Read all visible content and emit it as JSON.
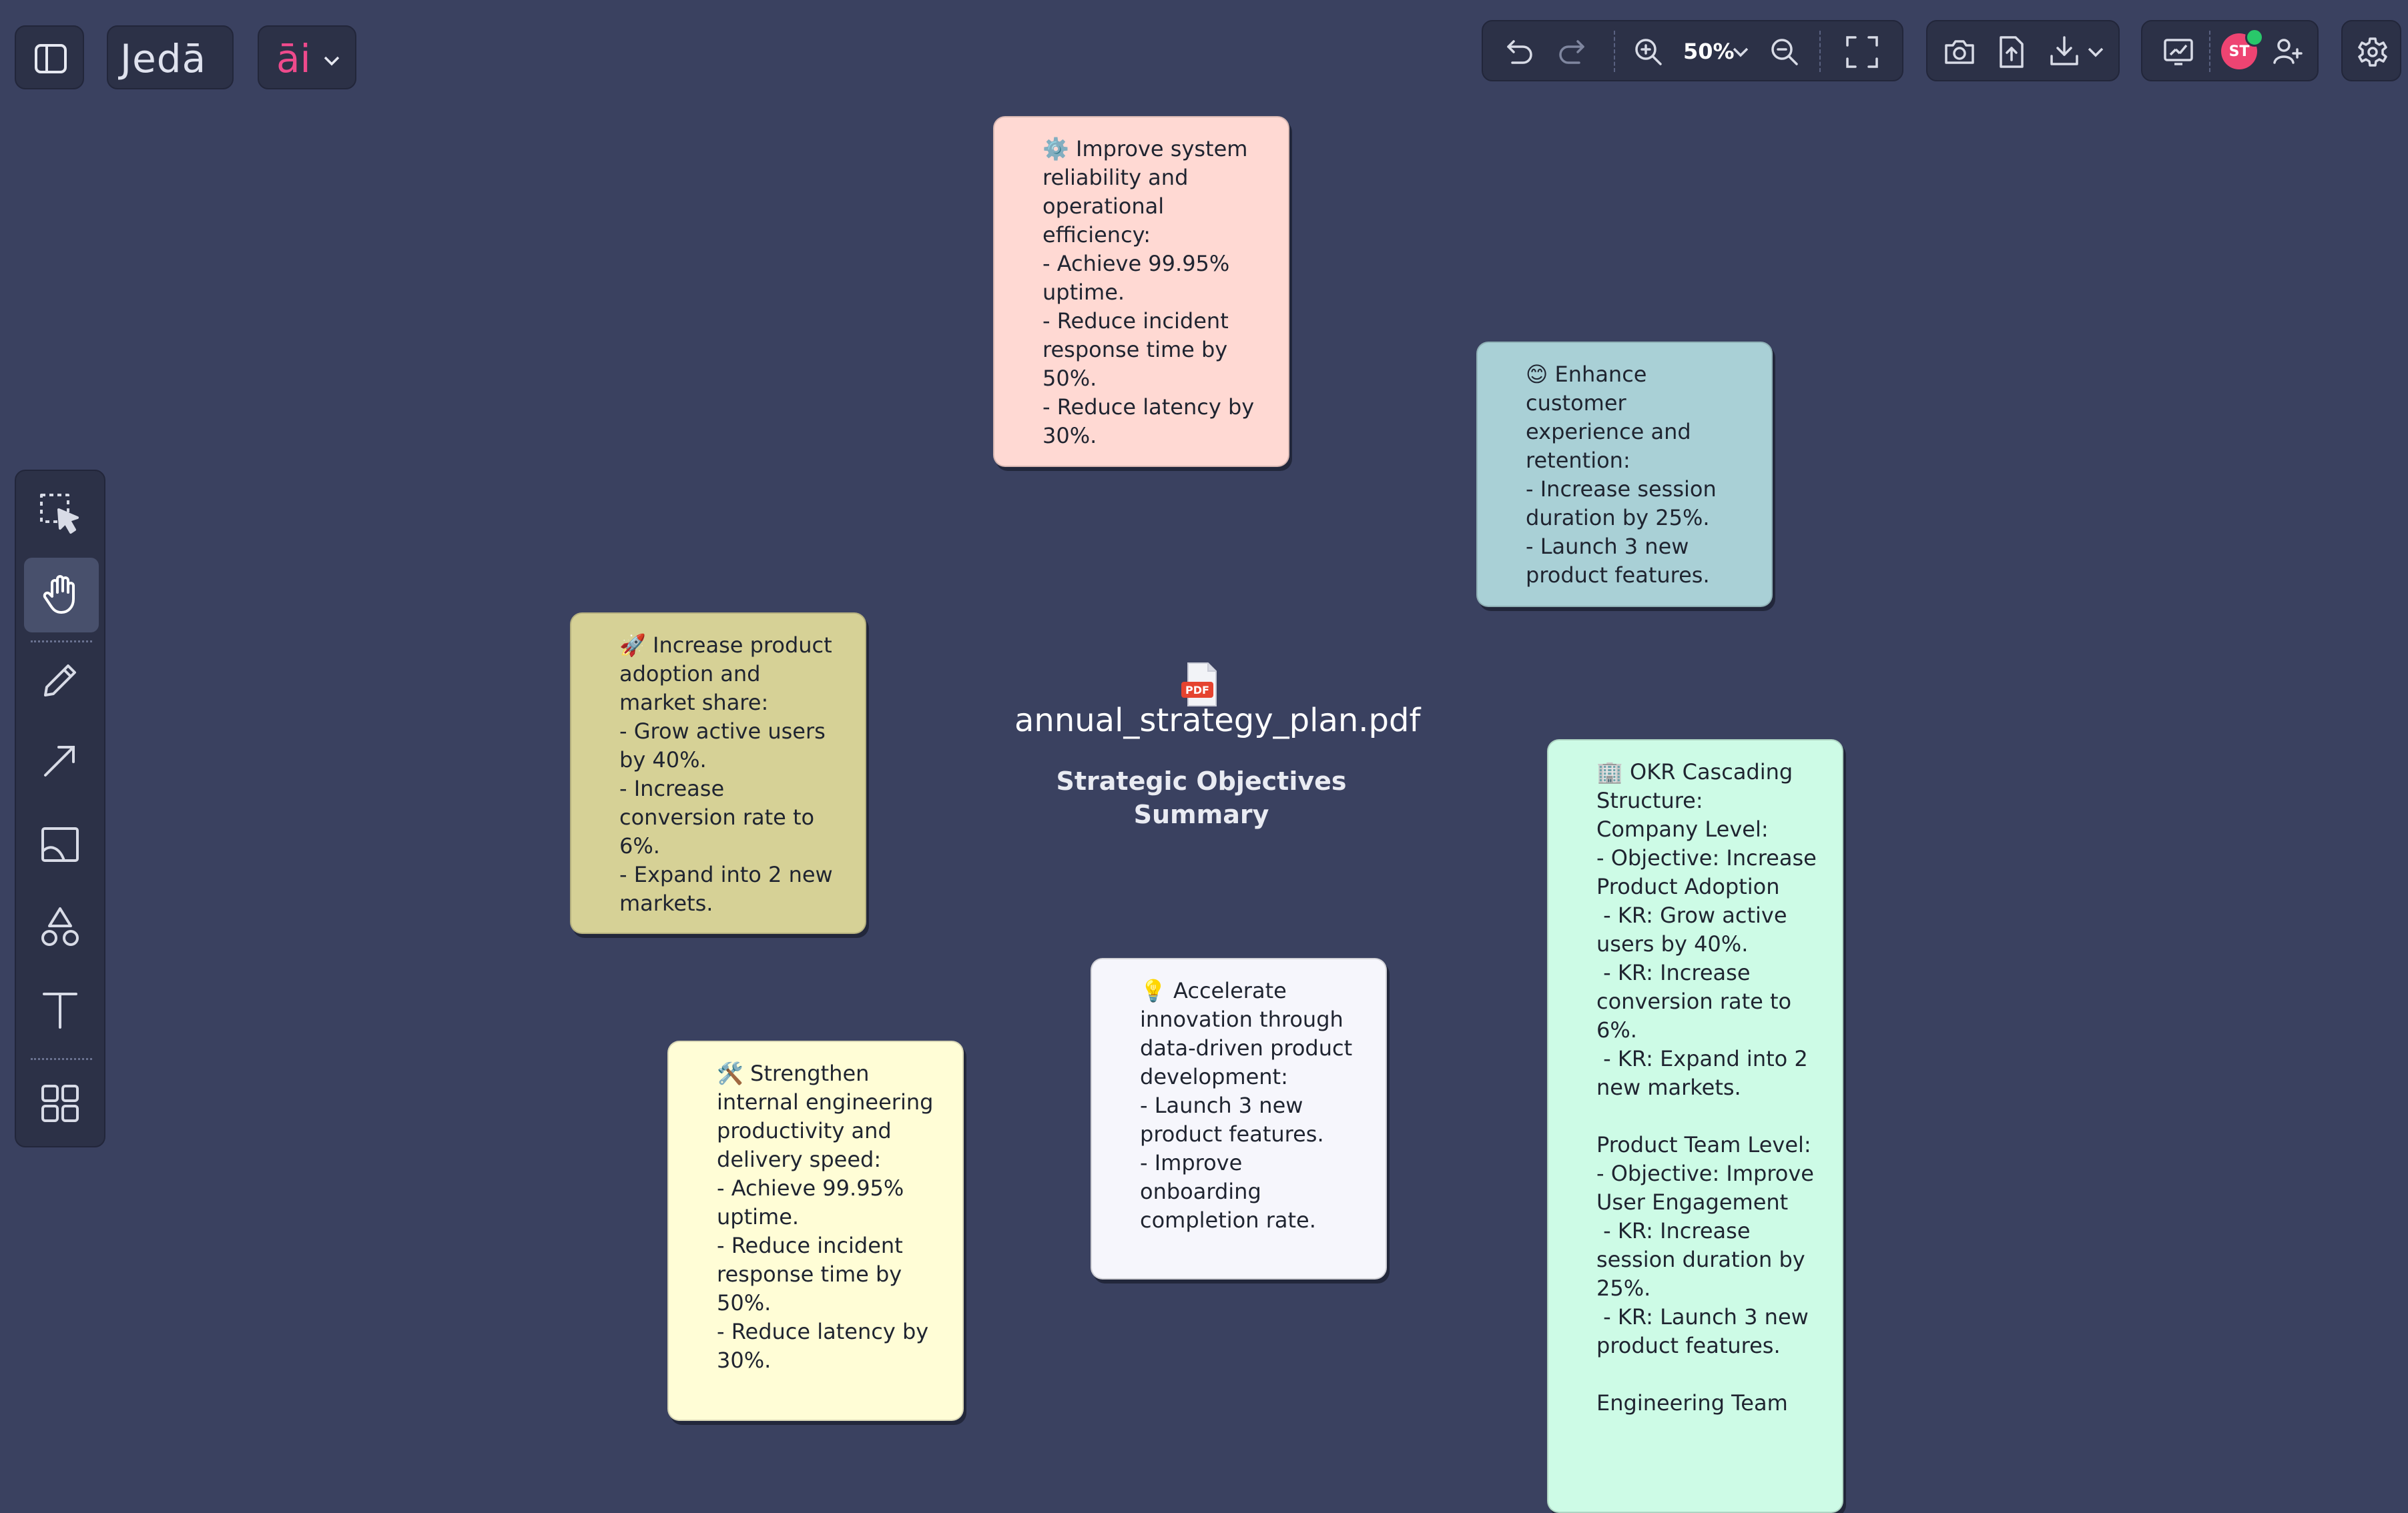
{
  "app": {
    "logo_text": "Jedā",
    "ai_label": "āi"
  },
  "toolbar": {
    "zoom_level": "50%"
  },
  "user": {
    "initials": "ST",
    "status_color": "#29c86a"
  },
  "colors": {
    "canvas_background": "#3a4160",
    "toolbar_background": "#2c3147",
    "logo_accent": "#ee4a8c"
  },
  "document": {
    "file_name": "annual_strategy_plan.pdf",
    "file_badge": "PDF",
    "subtitle": "Strategic Objectives\nSummary"
  },
  "notes": [
    {
      "color": "#ffd9d3",
      "text": "⚙️ Improve system reliability and operational efficiency:\n- Achieve 99.95% uptime.\n- Reduce incident response time by 50%.\n- Reduce latency by 30%."
    },
    {
      "color": "#a9d0d6",
      "text": "😊 Enhance customer experience and retention:\n- Increase session duration by 25%.\n- Launch 3 new product features."
    },
    {
      "color": "#d6d196",
      "text": "🚀 Increase product adoption and market share:\n- Grow active users by 40%.\n- Increase conversion rate to 6%.\n- Expand into 2 new markets."
    },
    {
      "color": "#f6f6fc",
      "text": "💡 Accelerate innovation through data-driven product development:\n- Launch 3 new product features.\n- Improve onboarding completion rate."
    },
    {
      "color": "#fffdd6",
      "text": "🛠️ Strengthen internal engineering productivity and delivery speed:\n- Achieve 99.95% uptime.\n- Reduce incident response time by 50%.\n- Reduce latency by 30%."
    },
    {
      "color": "#cdfbe6",
      "text": "🏢 OKR Cascading Structure:\nCompany Level:\n- Objective: Increase Product Adoption\n - KR: Grow active users by 40%.\n - KR: Increase conversion rate to 6%.\n - KR: Expand into 2 new markets.\n\nProduct Team Level:\n- Objective: Improve User Engagement\n - KR: Increase session duration by 25%.\n - KR: Launch 3 new product features.\n\nEngineering Team"
    }
  ],
  "icons": {
    "top_left": [
      "sidebar-toggle-icon"
    ],
    "history": [
      "undo-icon",
      "redo-icon"
    ],
    "zoom": [
      "zoom-in-icon",
      "chevron-down-icon",
      "zoom-out-icon",
      "fit-screen-icon"
    ],
    "export": [
      "camera-icon",
      "upload-icon",
      "download-icon"
    ],
    "collab": [
      "present-icon",
      "add-user-icon"
    ],
    "settings": [
      "gear-icon"
    ],
    "tools": [
      "select-icon",
      "hand-icon",
      "pencil-icon",
      "arrow-icon",
      "image-icon",
      "shapes-icon",
      "text-icon",
      "grid-icon"
    ]
  }
}
